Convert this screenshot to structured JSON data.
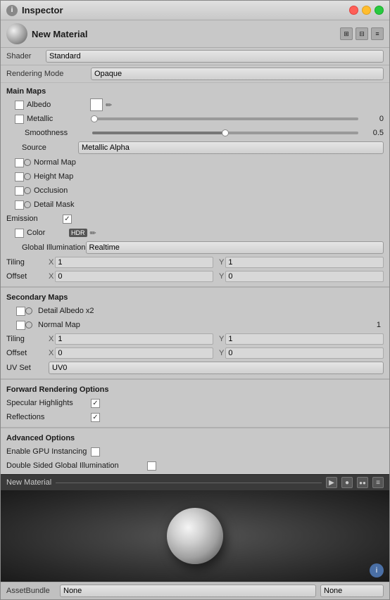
{
  "window": {
    "title": "Inspector",
    "material_name": "New Material",
    "shader_label": "Shader",
    "shader_value": "Standard"
  },
  "rendering": {
    "label": "Rendering Mode",
    "value": "Opaque"
  },
  "main_maps": {
    "title": "Main Maps",
    "albedo_label": "Albedo",
    "metallic_label": "Metallic",
    "metallic_value": "0",
    "smoothness_label": "Smoothness",
    "smoothness_value": "0.5",
    "smoothness_percent": 50,
    "source_label": "Source",
    "source_value": "Metallic Alpha",
    "normal_map_label": "Normal Map",
    "height_map_label": "Height Map",
    "occlusion_label": "Occlusion",
    "detail_mask_label": "Detail Mask",
    "emission_label": "Emission",
    "emission_checked": true,
    "color_label": "Color",
    "gi_label": "Global Illumination",
    "gi_value": "Realtime",
    "tiling_label": "Tiling",
    "tiling_x": "1",
    "tiling_y": "1",
    "offset_label": "Offset",
    "offset_x": "0",
    "offset_y": "0"
  },
  "secondary_maps": {
    "title": "Secondary Maps",
    "detail_albedo_label": "Detail Albedo x2",
    "normal_map_label": "Normal Map",
    "normal_value": "1",
    "tiling_label": "Tiling",
    "tiling_x": "1",
    "tiling_y": "1",
    "offset_label": "Offset",
    "offset_x": "0",
    "offset_y": "0",
    "uv_label": "UV Set",
    "uv_value": "UV0"
  },
  "forward_rendering": {
    "title": "Forward Rendering Options",
    "specular_label": "Specular Highlights",
    "specular_checked": true,
    "reflections_label": "Reflections",
    "reflections_checked": true
  },
  "advanced": {
    "title": "Advanced Options",
    "gpu_instancing_label": "Enable GPU Instancing",
    "gpu_instancing_checked": false,
    "double_sided_label": "Double Sided Global Illumination",
    "double_sided_checked": false
  },
  "preview": {
    "material_name": "New Material",
    "play_icon": "▶",
    "circle_icon": "●",
    "dots_icon": "●●"
  },
  "asset_bundle": {
    "label": "AssetBundle",
    "value1": "None",
    "value2": "None"
  }
}
